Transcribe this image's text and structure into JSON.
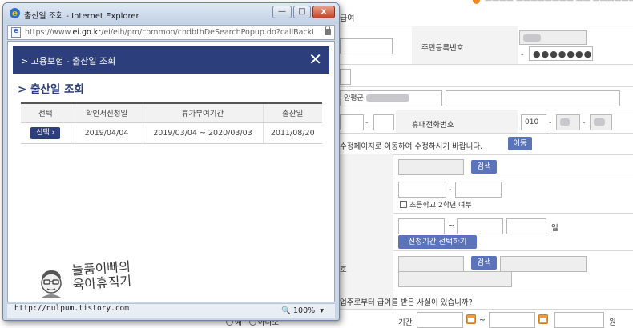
{
  "background_form": {
    "top_note": "———— ———————— —— ———————",
    "header_label": "급여",
    "resident_number": {
      "label": "주민등록번호",
      "masked": "●●●●●●●",
      "dash": "-"
    },
    "address_label": "양평군",
    "mobile": {
      "label": "휴대전화번호",
      "prefix": "010",
      "dash": "-"
    },
    "notice": "수정페이지로 이동하여 수정하시기 바랍니다.",
    "move_button": "이동",
    "search_button_1": "검색",
    "dash": "-",
    "tilde": "~",
    "elementary_checkbox": "초등학교 2학년 여부",
    "day_unit": "일",
    "period_button": "신청기간 선택하기",
    "search_button_2": "검색",
    "row_label_partial": "호",
    "question": "업주로부터 급여를 받은 사실이 있습니까?",
    "radio_yes": "예",
    "radio_no": "아니오",
    "period_label": "기간",
    "won_unit": "원"
  },
  "popup": {
    "window_title": "출산일 조회 - Internet Explorer",
    "window_controls": {
      "minimize": "—",
      "maximize": "□",
      "close": "x"
    },
    "url_prefix": "https://www.",
    "url_domain": "ei.go.kr",
    "url_rest": "/ei/eih/pm/common/chdbthDeSearchPopup.do?callBackFunc=fi",
    "modal_title": "> 고용보험 - 출산일 조회",
    "close_glyph": "✕",
    "section_title": "> 출산일 조회",
    "table": {
      "headers": [
        "선택",
        "확인서신청일",
        "휴가부여기간",
        "출산일"
      ],
      "rows": [
        {
          "select_label": "선택 ›",
          "confirm_date": "2019/04/04",
          "leave_period": "2019/03/04 ~ 2020/03/03",
          "birth_date": "2011/08/20"
        }
      ]
    },
    "zoom": "100%",
    "zoom_arrow": "▾"
  },
  "watermark": {
    "line1": "늘품이빠의",
    "line2": "육아휴직기",
    "url": "http://nulpum.tistory.com"
  },
  "colors": {
    "accent_navy": "#2c3f7c",
    "button_blue": "#5b73b8",
    "calendar_orange": "#f29a3c"
  }
}
